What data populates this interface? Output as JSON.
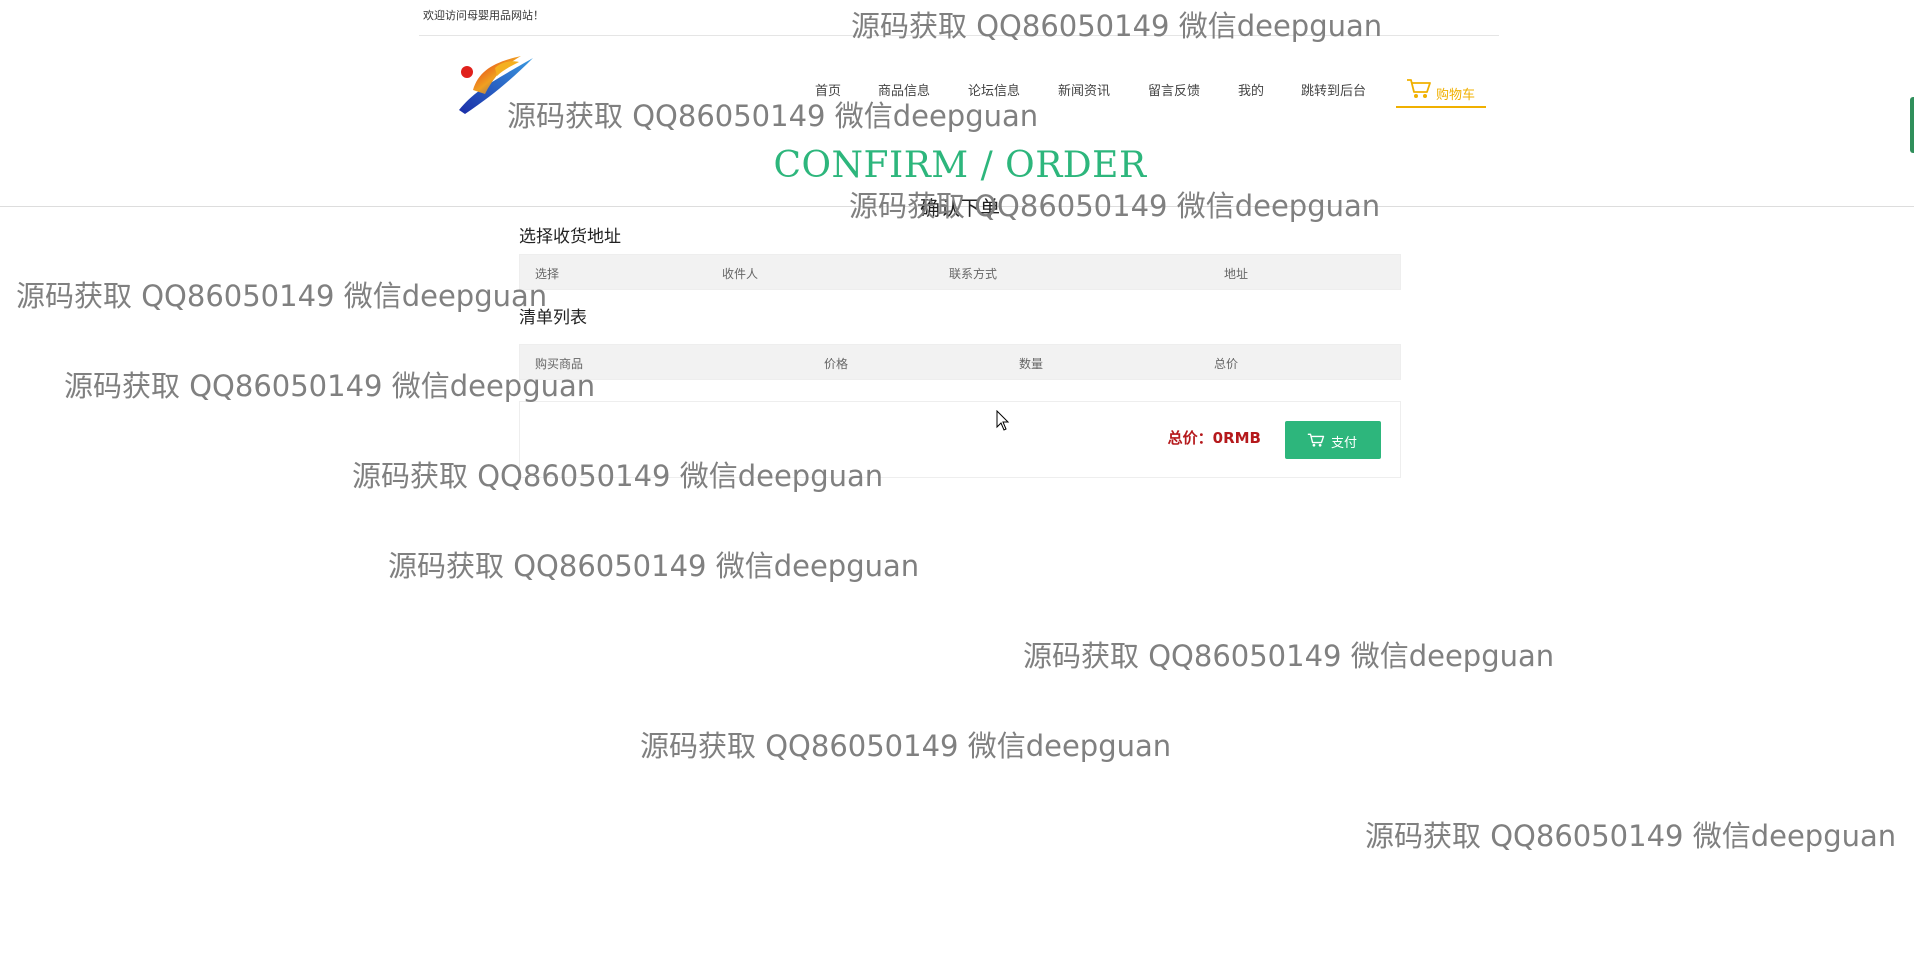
{
  "header": {
    "welcome": "欢迎访问母婴用品网站！"
  },
  "nav": {
    "items": [
      {
        "label": "首页",
        "name": "nav-home"
      },
      {
        "label": "商品信息",
        "name": "nav-products"
      },
      {
        "label": "论坛信息",
        "name": "nav-forum"
      },
      {
        "label": "新闻资讯",
        "name": "nav-news"
      },
      {
        "label": "留言反馈",
        "name": "nav-feedback"
      },
      {
        "label": "我的",
        "name": "nav-my"
      },
      {
        "label": "跳转到后台",
        "name": "nav-admin"
      }
    ],
    "cart": {
      "label": "购物车",
      "icon": "shopping-cart-icon",
      "color": "#f0b000"
    }
  },
  "page": {
    "title_en": "CONFIRM / ORDER",
    "title_cn": "确认下单",
    "title_color": "#2db67c"
  },
  "address": {
    "label": "选择收货地址",
    "columns": [
      "选择",
      "收件人",
      "联系方式",
      "地址"
    ],
    "rows": []
  },
  "orders": {
    "label": "清单列表",
    "columns": [
      "购买商品",
      "价格",
      "数量",
      "总价"
    ],
    "rows": []
  },
  "summary": {
    "total_text": "总价：0RMB",
    "total_color": "#b5191c",
    "pay_label": "支付",
    "pay_icon": "shopping-cart-icon",
    "pay_color": "#2db67c"
  },
  "watermark": {
    "text": "源码获取 QQ86050149 微信deepguan"
  }
}
